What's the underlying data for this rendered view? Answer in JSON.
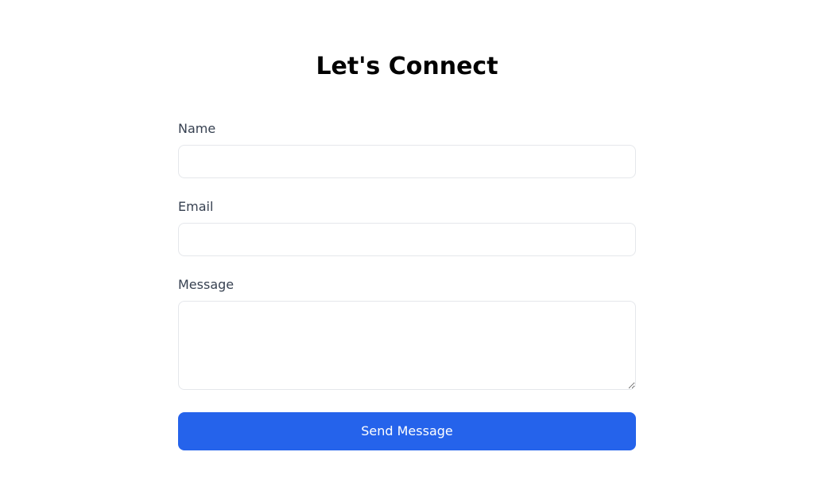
{
  "heading": "Let's Connect",
  "form": {
    "name": {
      "label": "Name",
      "value": ""
    },
    "email": {
      "label": "Email",
      "value": ""
    },
    "message": {
      "label": "Message",
      "value": ""
    },
    "submit_label": "Send Message"
  }
}
